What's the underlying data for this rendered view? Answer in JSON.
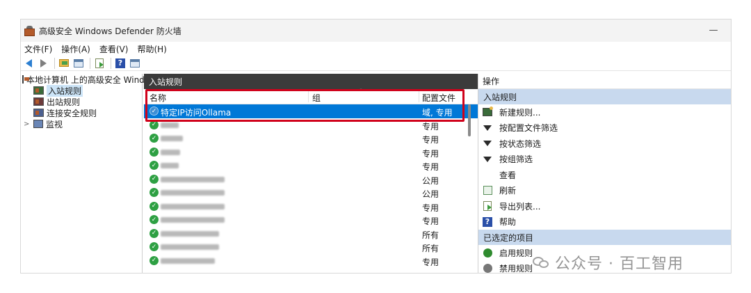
{
  "window": {
    "title": "高级安全 Windows Defender 防火墙",
    "minimize": "—"
  },
  "menu": [
    "文件(F)",
    "操作(A)",
    "查看(V)",
    "帮助(H)"
  ],
  "toolbar": {
    "help_glyph": "?"
  },
  "tree": [
    {
      "label": "本地计算机 上的高级安全 Wind",
      "icon": "computer-icon",
      "indent": 0,
      "selected": false
    },
    {
      "label": "入站规则",
      "icon": "inbound-rules-icon",
      "indent": 1,
      "selected": true
    },
    {
      "label": "出站规则",
      "icon": "outbound-rules-icon",
      "indent": 1,
      "selected": false
    },
    {
      "label": "连接安全规则",
      "icon": "connection-security-icon",
      "indent": 1,
      "selected": false
    },
    {
      "label": "监视",
      "icon": "monitor-icon",
      "indent": 1,
      "selected": false,
      "chevron": ">"
    }
  ],
  "middle": {
    "header": "入站规则",
    "columns": {
      "name": "名称",
      "group": "组",
      "profile": "配置文件"
    },
    "rows": [
      {
        "name": "特定IP访问Ollama",
        "profile": "域, 专用",
        "selected": true,
        "blur_width": 0
      },
      {
        "name": "",
        "profile": "专用",
        "selected": false,
        "blur_width": 26
      },
      {
        "name": "",
        "profile": "专用",
        "selected": false,
        "blur_width": 32
      },
      {
        "name": "",
        "profile": "专用",
        "selected": false,
        "blur_width": 28
      },
      {
        "name": "",
        "profile": "专用",
        "selected": false,
        "blur_width": 26
      },
      {
        "name": "",
        "profile": "公用",
        "selected": false,
        "blur_width": 92
      },
      {
        "name": "",
        "profile": "公用",
        "selected": false,
        "blur_width": 92
      },
      {
        "name": "",
        "profile": "专用",
        "selected": false,
        "blur_width": 92
      },
      {
        "name": "",
        "profile": "专用",
        "selected": false,
        "blur_width": 92
      },
      {
        "name": "",
        "profile": "所有",
        "selected": false,
        "blur_width": 84
      },
      {
        "name": "",
        "profile": "所有",
        "selected": false,
        "blur_width": 84
      },
      {
        "name": "",
        "profile": "专用",
        "selected": false,
        "blur_width": 78
      }
    ],
    "check_glyph": "✓"
  },
  "actions": {
    "header": "操作",
    "section1": "入站规则",
    "items1": [
      {
        "label": "新建规则...",
        "icon": "new-rule-icon"
      },
      {
        "label": "按配置文件筛选",
        "icon": "filter-icon"
      },
      {
        "label": "按状态筛选",
        "icon": "filter-icon"
      },
      {
        "label": "按组筛选",
        "icon": "filter-icon"
      },
      {
        "label": "查看",
        "icon": ""
      },
      {
        "label": "刷新",
        "icon": "refresh-icon"
      },
      {
        "label": "导出列表...",
        "icon": "export-icon"
      },
      {
        "label": "帮助",
        "icon": "help-icon"
      }
    ],
    "section2": "已选定的项目",
    "items2": [
      {
        "label": "启用规则",
        "icon": "enable-rule-icon"
      },
      {
        "label": "禁用规则",
        "icon": "disable-rule-icon"
      }
    ]
  },
  "watermark": {
    "text": "公众号 · 百工智用"
  }
}
